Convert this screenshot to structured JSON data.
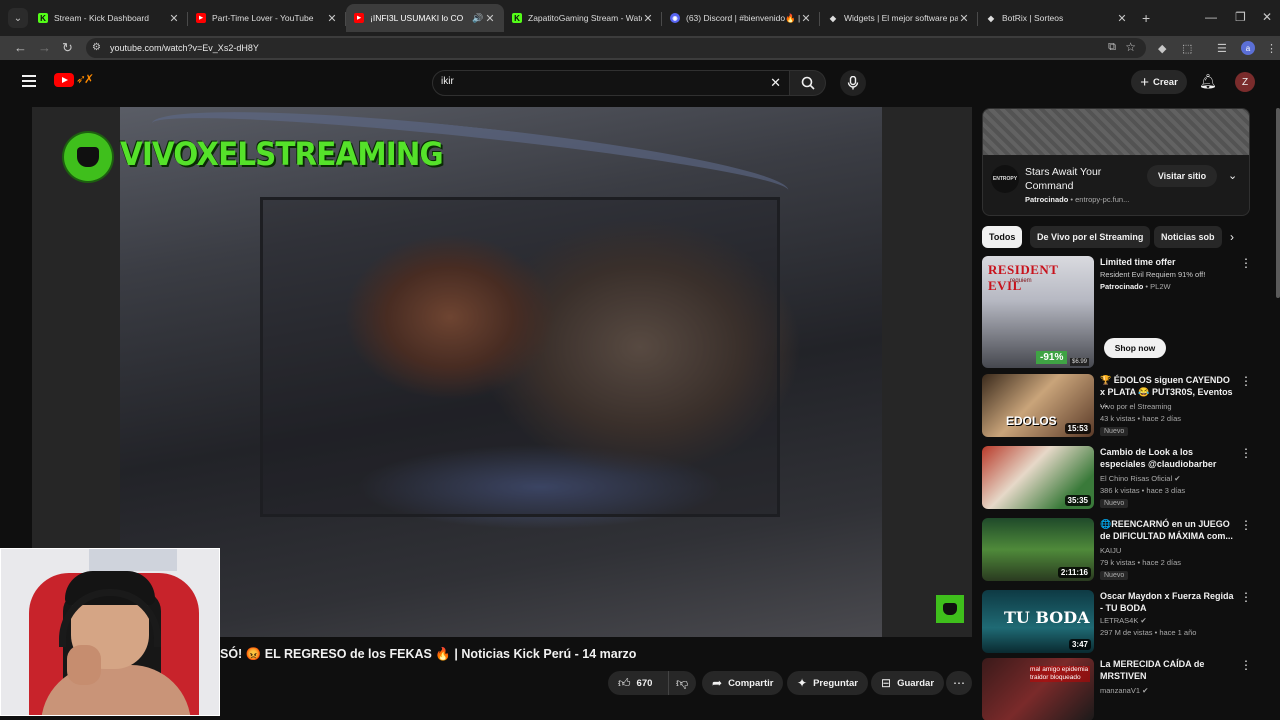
{
  "browser": {
    "tabs": [
      {
        "title": "Stream - Kick Dashboard",
        "fav_color": "#53fc18",
        "fav_char": "K",
        "active": false
      },
      {
        "title": "Part-Time Lover - YouTube",
        "fav_color": "#ff0000",
        "fav_char": "▶",
        "active": false
      },
      {
        "title": "¡INFI3L USUMAKI lo CO",
        "fav_color": "#ff0000",
        "fav_char": "▶",
        "active": true
      },
      {
        "title": "ZapatitoGaming Stream - Watc",
        "fav_color": "#53fc18",
        "fav_char": "K",
        "active": false
      },
      {
        "title": "(63) Discord | #bienvenido🔥 |",
        "fav_color": "#5865f2",
        "fav_char": "◉",
        "active": false
      },
      {
        "title": "Widgets | El mejor software pa",
        "fav_color": "#dddddd",
        "fav_char": "◆",
        "active": false
      },
      {
        "title": "BotRix | Sorteos",
        "fav_color": "#dddddd",
        "fav_char": "◆",
        "active": false
      }
    ],
    "url": "youtube.com/watch?v=Ev_Xs2-dH8Y",
    "profile_initial": "a"
  },
  "youtube": {
    "search_value": "ikir",
    "create_label": "Crear",
    "avatar_initial": "Z"
  },
  "video": {
    "watermark": "VIVOXELSTREAMING",
    "title": "SÓ! 😡 EL REGRESO de los FEKAS 🔥 | Noticias Kick Perú - 14 marzo",
    "likes": "670",
    "share_label": "Compartir",
    "ask_label": "Preguntar",
    "save_label": "Guardar"
  },
  "sidebar": {
    "ad": {
      "logo_text": "ENTROPY",
      "title": "Stars Await Your Command",
      "sponsored": "Patrocinado",
      "domain": "entropy-pc.fun...",
      "visit_label": "Visitar sitio"
    },
    "chips": [
      "Todos",
      "De Vivo por el Streaming",
      "Noticias sob"
    ],
    "recs": [
      {
        "title": "Limited time offer",
        "channel": "Resident Evil Requiem 91% off!",
        "sponsored": "Patrocinado",
        "sponsor_name": "PL2W",
        "cta": "Shop now",
        "thumb_logo": "RESIDENT EVIL",
        "thumb_sub": "requiem",
        "discount": "-91%",
        "price": "$6.99"
      },
      {
        "title": "🏆 ÉDOLOS siguen CAYENDO x PLATA 😂 PUT3R0S, Eventos ...",
        "channel": "Vivo por el Streaming",
        "meta": "43 k vistas • hace 2 días",
        "badge": "Nuevo",
        "duration": "15:53",
        "thumb_text": "EDOLOS"
      },
      {
        "title": "Cambio de Look a los especiales @claudiobarber",
        "channel": "El Chino Risas Oficial ✔",
        "meta": "386 k vistas • hace 3 días",
        "badge": "Nuevo",
        "duration": "35:35"
      },
      {
        "title": "🌐REENCARNÓ en un JUEGO de DIFICULTAD MÁXIMA com...",
        "channel": "KAIJU",
        "meta": "79 k vistas • hace 2 días",
        "badge": "Nuevo",
        "duration": "2:11:16"
      },
      {
        "title": "Oscar Maydon x Fuerza Regida - TU BODA",
        "channel": "LETRAS4K ✔",
        "meta": "297 M de vistas • hace 1 año",
        "duration": "3:47",
        "thumb_text": "TU BODA"
      },
      {
        "title": "La MERECIDA CAÍDA de MRSTIVEN",
        "channel": "manzanaV1 ✔",
        "thumb_text": "mal amigo epidemia traidor bloqueado"
      }
    ]
  },
  "colors": {
    "yt_bg": "#0f0f0f",
    "accent_green": "#53fc18",
    "yt_red": "#ff0000"
  }
}
